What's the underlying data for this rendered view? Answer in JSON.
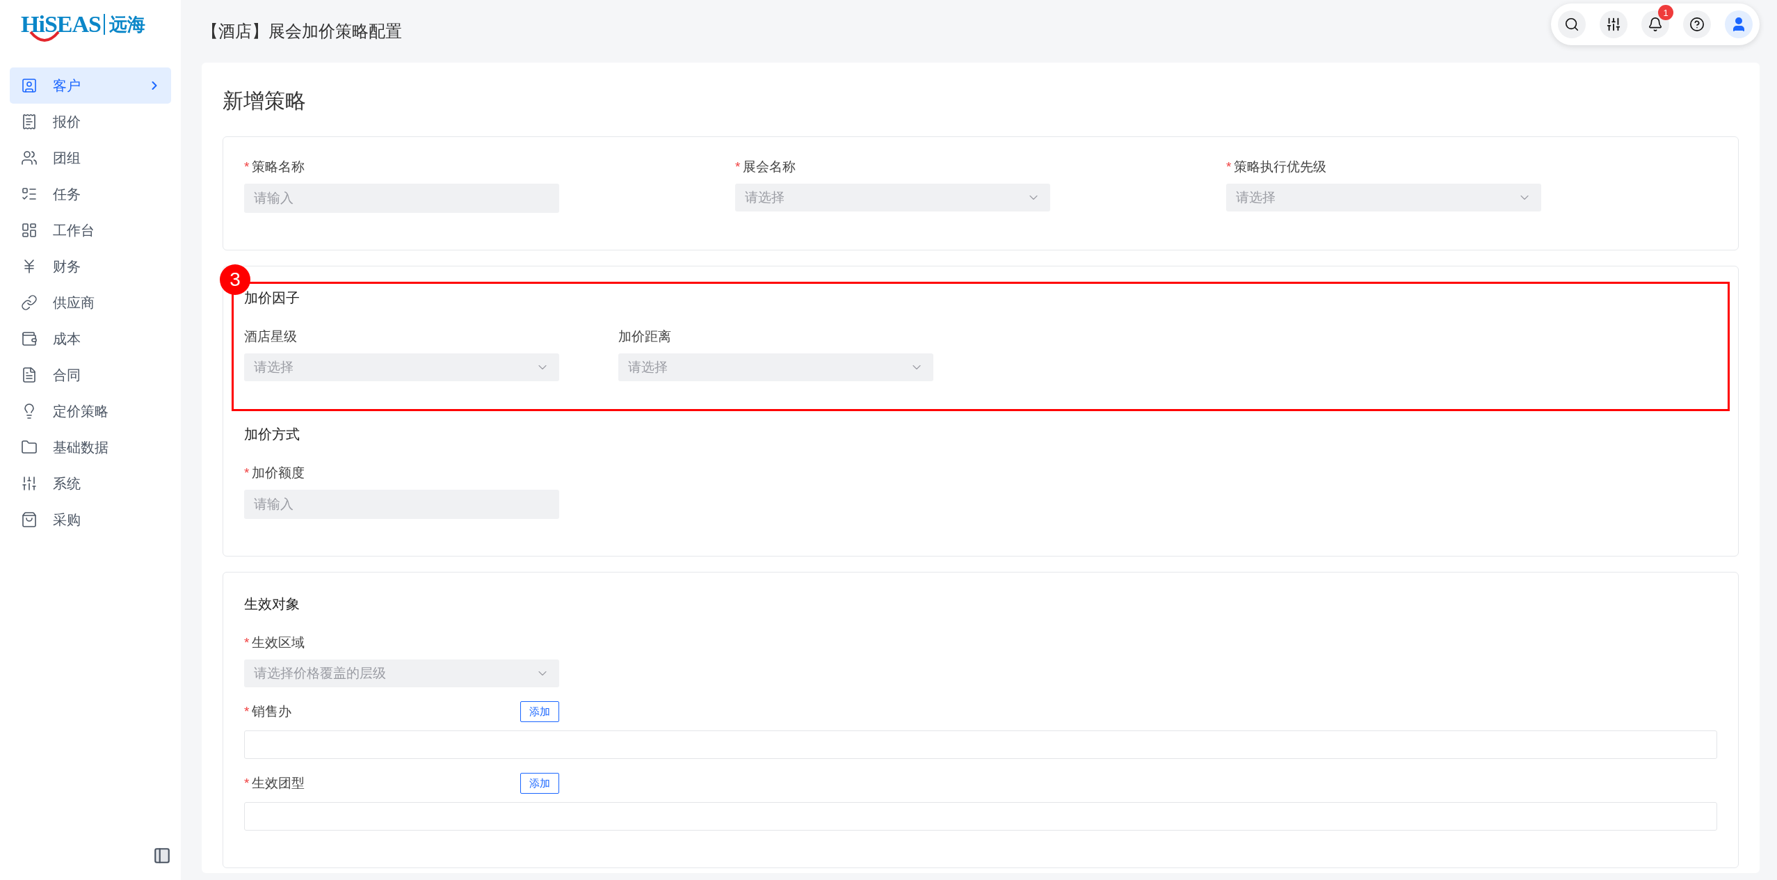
{
  "logo": {
    "brand": "HiSEAS",
    "name": "远海"
  },
  "sidebar": {
    "items": [
      {
        "label": "客户",
        "selected": true
      },
      {
        "label": "报价",
        "selected": false
      },
      {
        "label": "团组",
        "selected": false
      },
      {
        "label": "任务",
        "selected": false
      },
      {
        "label": "工作台",
        "selected": false
      },
      {
        "label": "财务",
        "selected": false
      },
      {
        "label": "供应商",
        "selected": false
      },
      {
        "label": "成本",
        "selected": false
      },
      {
        "label": "合同",
        "selected": false
      },
      {
        "label": "定价策略",
        "selected": false
      },
      {
        "label": "基础数据",
        "selected": false
      },
      {
        "label": "系统",
        "selected": false
      },
      {
        "label": "采购",
        "selected": false
      }
    ]
  },
  "header": {
    "title": "【酒店】展会加价策略配置",
    "notification_count": "1"
  },
  "page": {
    "title": "新增策略"
  },
  "sections": [
    {
      "groups": [
        {
          "kind": "columns",
          "fields": [
            {
              "kind": "input",
              "marker": "*",
              "label": "策略名称",
              "placeholder": "请输入"
            },
            {
              "kind": "select",
              "marker": "*",
              "label": "展会名称",
              "placeholder": "请选择"
            },
            {
              "kind": "select",
              "marker": "*",
              "label": "策略执行优先级",
              "placeholder": "请选择"
            }
          ]
        }
      ]
    },
    {
      "groups": [
        {
          "kind": "row",
          "title": "加价因子",
          "annotation": "3",
          "fields": [
            {
              "kind": "select",
              "label": "酒店星级",
              "placeholder": "请选择"
            },
            {
              "kind": "select",
              "label": "加价距离",
              "placeholder": "请选择"
            }
          ]
        },
        {
          "kind": "stack",
          "title": "加价方式",
          "fields": [
            {
              "kind": "input",
              "marker": "*",
              "label": "加价额度",
              "placeholder": "请输入"
            }
          ]
        }
      ]
    },
    {
      "groups": [
        {
          "kind": "stack",
          "title": "生效对象",
          "fields": [
            {
              "kind": "select",
              "marker": "*",
              "label": "生效区域",
              "placeholder": "请选择价格覆盖的层级"
            },
            {
              "kind": "list",
              "marker": "*",
              "label": "销售办",
              "button": "添加"
            },
            {
              "kind": "list",
              "marker": "*",
              "label": "生效团型",
              "button": "添加"
            }
          ]
        }
      ]
    }
  ]
}
